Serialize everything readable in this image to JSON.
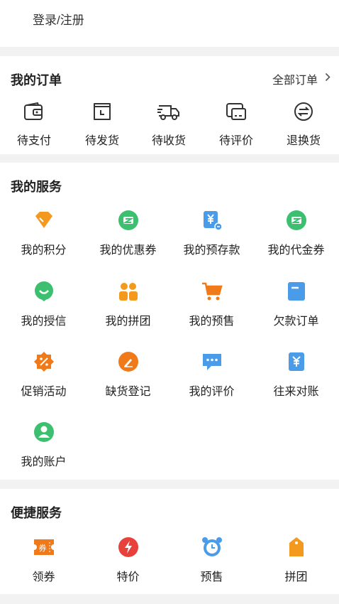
{
  "login": {
    "label": "登录/注册"
  },
  "orders": {
    "title": "我的订单",
    "all_label": "全部订单",
    "items": [
      {
        "label": "待支付",
        "icon": "wallet-icon"
      },
      {
        "label": "待发货",
        "icon": "clock-box-icon"
      },
      {
        "label": "待收货",
        "icon": "truck-icon"
      },
      {
        "label": "待评价",
        "icon": "comment-card-icon"
      },
      {
        "label": "退换货",
        "icon": "exchange-icon"
      }
    ]
  },
  "services": {
    "title": "我的服务",
    "items": [
      {
        "label": "我的积分",
        "icon": "diamond-icon",
        "color": "#f39a1e"
      },
      {
        "label": "我的优惠券",
        "icon": "coupon-icon",
        "color": "#3cbf6f"
      },
      {
        "label": "我的预存款",
        "icon": "yen-deposit-icon",
        "color": "#4a9be8"
      },
      {
        "label": "我的代金券",
        "icon": "voucher-icon",
        "color": "#3cbf6f"
      },
      {
        "label": "我的授信",
        "icon": "smile-icon",
        "color": "#3cbf6f"
      },
      {
        "label": "我的拼团",
        "icon": "group-icon",
        "color": "#f39a1e"
      },
      {
        "label": "我的预售",
        "icon": "cart-icon",
        "color": "#f07a1a"
      },
      {
        "label": "欠款订单",
        "icon": "document-icon",
        "color": "#4a9be8"
      },
      {
        "label": "促销活动",
        "icon": "percent-badge-icon",
        "color": "#f07a1a"
      },
      {
        "label": "缺货登记",
        "icon": "edit-icon",
        "color": "#f07a1a"
      },
      {
        "label": "我的评价",
        "icon": "chat-bubble-icon",
        "color": "#4a9be8"
      },
      {
        "label": "往来对账",
        "icon": "yen-doc-icon",
        "color": "#4a9be8"
      },
      {
        "label": "我的账户",
        "icon": "user-icon",
        "color": "#3cbf6f"
      }
    ]
  },
  "quick": {
    "title": "便捷服务",
    "items": [
      {
        "label": "领券",
        "icon": "ticket-icon",
        "badge": "券",
        "color": "#f07a1a"
      },
      {
        "label": "特价",
        "icon": "lightning-icon",
        "color": "#e8413c"
      },
      {
        "label": "预售",
        "icon": "alarm-clock-icon",
        "color": "#4a9be8"
      },
      {
        "label": "拼团",
        "icon": "tag-icon",
        "color": "#f39a1e"
      }
    ]
  }
}
